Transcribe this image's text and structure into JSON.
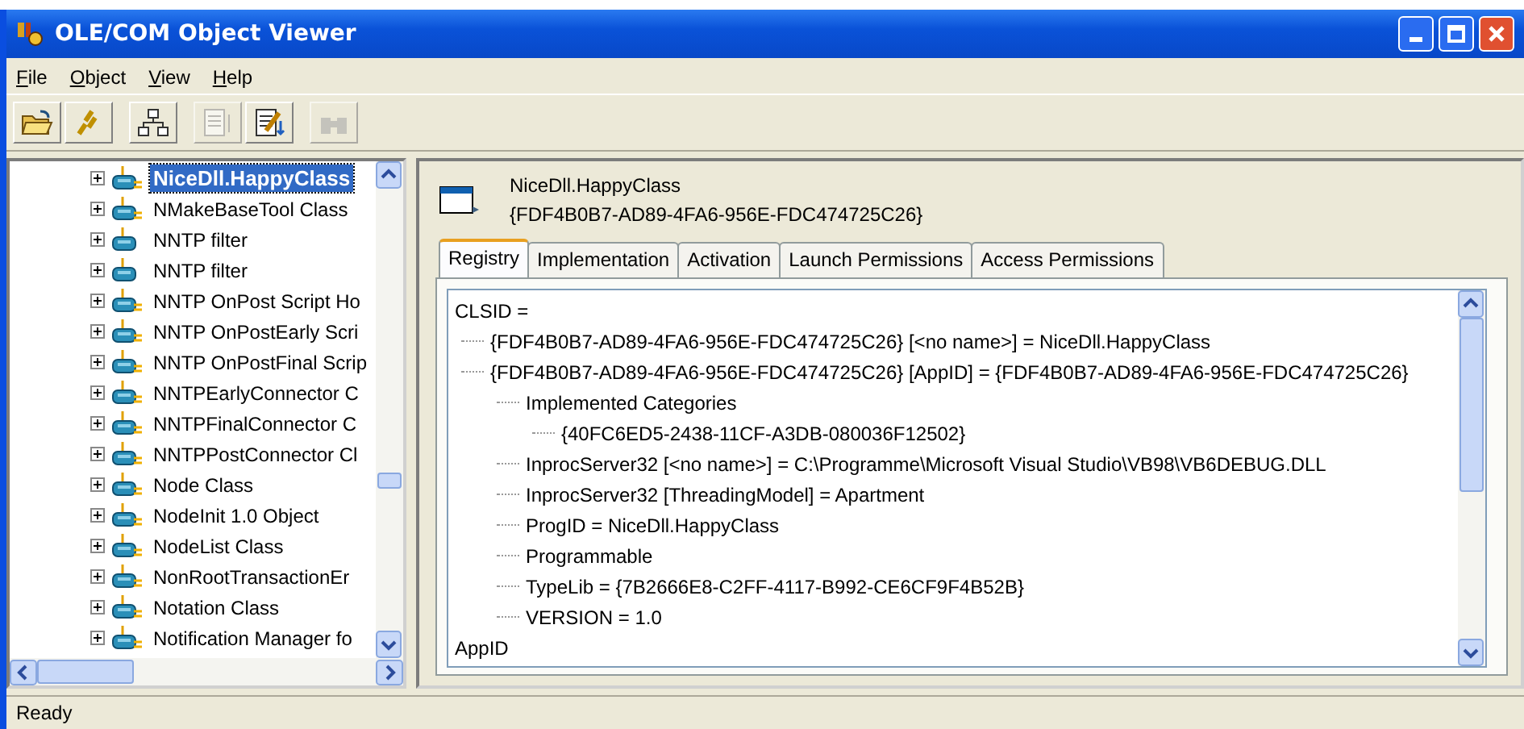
{
  "window": {
    "title": "OLE/COM Object Viewer"
  },
  "menu": [
    "File",
    "Object",
    "View",
    "Help"
  ],
  "toolbar": [
    {
      "disabled": false
    },
    {
      "disabled": false
    },
    {
      "disabled": false
    },
    {
      "disabled": true
    },
    {
      "disabled": false
    },
    {
      "disabled": true
    }
  ],
  "tree": [
    {
      "label": "NiceDll.HappyClass",
      "kind": "class32",
      "selected": true
    },
    {
      "label": "NMakeBaseTool Class",
      "kind": "class32",
      "selected": false
    },
    {
      "label": "NNTP filter",
      "kind": "class",
      "selected": false
    },
    {
      "label": "NNTP filter",
      "kind": "class",
      "selected": false
    },
    {
      "label": "NNTP OnPost Script Ho",
      "kind": "class32",
      "selected": false
    },
    {
      "label": "NNTP OnPostEarly Scri",
      "kind": "class32",
      "selected": false
    },
    {
      "label": "NNTP OnPostFinal Scrip",
      "kind": "class32",
      "selected": false
    },
    {
      "label": "NNTPEarlyConnector C",
      "kind": "class32",
      "selected": false
    },
    {
      "label": "NNTPFinalConnector C",
      "kind": "class32",
      "selected": false
    },
    {
      "label": "NNTPPostConnector Cl",
      "kind": "class32",
      "selected": false
    },
    {
      "label": "Node Class",
      "kind": "class32",
      "selected": false
    },
    {
      "label": "NodeInit 1.0 Object",
      "kind": "class32",
      "selected": false
    },
    {
      "label": "NodeList Class",
      "kind": "class32",
      "selected": false
    },
    {
      "label": "NonRootTransactionEr",
      "kind": "class32",
      "selected": false
    },
    {
      "label": "Notation Class",
      "kind": "class32",
      "selected": false
    },
    {
      "label": "Notification Manager fo",
      "kind": "class32",
      "selected": false
    }
  ],
  "header": {
    "name": "NiceDll.HappyClass",
    "clsid": "{FDF4B0B7-AD89-4FA6-956E-FDC474725C26}"
  },
  "tabs": [
    {
      "label": "Registry",
      "selected": true
    },
    {
      "label": "Implementation",
      "selected": false
    },
    {
      "label": "Activation",
      "selected": false
    },
    {
      "label": "Launch Permissions",
      "selected": false
    },
    {
      "label": "Access Permissions",
      "selected": false
    }
  ],
  "registry": [
    {
      "text": "CLSID =",
      "children": [
        {
          "text": "{FDF4B0B7-AD89-4FA6-956E-FDC474725C26} [<no name>] = NiceDll.HappyClass"
        },
        {
          "text": "{FDF4B0B7-AD89-4FA6-956E-FDC474725C26} [AppID] = {FDF4B0B7-AD89-4FA6-956E-FDC474725C26}",
          "children": [
            {
              "text": "Implemented Categories",
              "children": [
                {
                  "text": "{40FC6ED5-2438-11CF-A3DB-080036F12502}"
                }
              ]
            },
            {
              "text": "InprocServer32 [<no name>] = C:\\Programme\\Microsoft Visual Studio\\VB98\\VB6DEBUG.DLL"
            },
            {
              "text": "InprocServer32 [ThreadingModel] = Apartment"
            },
            {
              "text": "ProgID = NiceDll.HappyClass"
            },
            {
              "text": "Programmable"
            },
            {
              "text": "TypeLib = {7B2666E8-C2FF-4117-B992-CE6CF9F4B52B}"
            },
            {
              "text": "VERSION = 1.0"
            }
          ]
        }
      ]
    },
    {
      "text": "AppID"
    }
  ],
  "status_bar": "Ready"
}
